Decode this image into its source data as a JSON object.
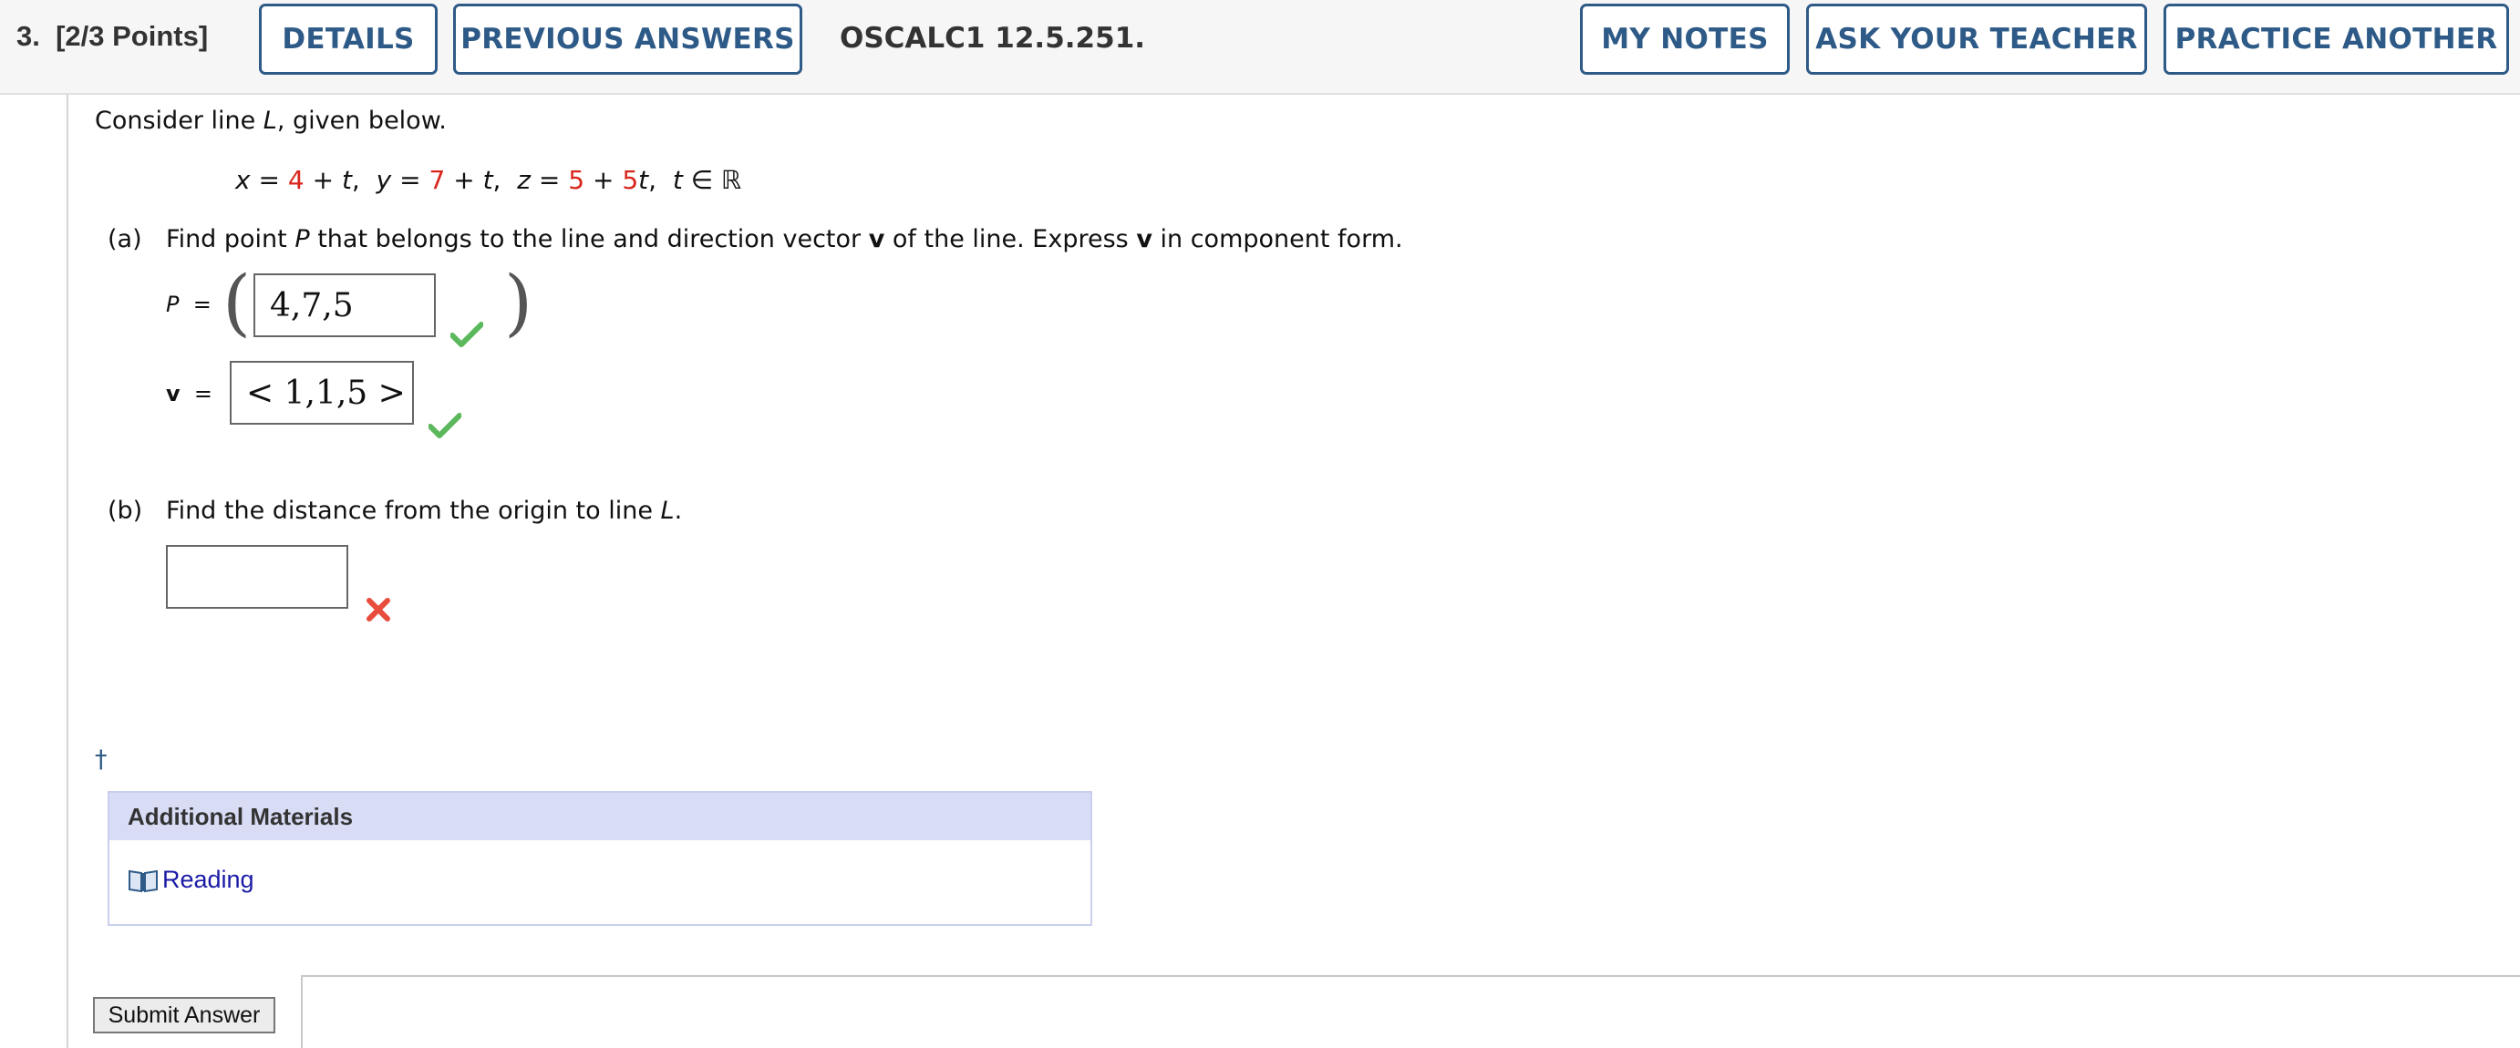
{
  "header": {
    "question_number": "3.",
    "points": "[2/3 Points]",
    "details_label": "DETAILS",
    "previous_answers_label": "PREVIOUS ANSWERS",
    "code": "OSCALC1 12.5.251.",
    "my_notes_label": "MY NOTES",
    "ask_teacher_label": "ASK YOUR TEACHER",
    "practice_label": "PRACTICE ANOTHER"
  },
  "problem": {
    "intro_prefix": "Consider line ",
    "intro_var": "L",
    "intro_suffix": ", given below.",
    "eq": {
      "x": "x",
      "eq1": " = ",
      "x0": "4",
      "x_rest": " + ",
      "t1": "t",
      "sep1": ",  ",
      "y": "y",
      "eq2": " = ",
      "y0": "7",
      "y_rest": " + ",
      "t2": "t",
      "sep2": ",  ",
      "z": "z",
      "eq3": " = ",
      "z0": "5",
      "z_rest": " + ",
      "zc": "5",
      "t3": "t",
      "sep3": ",  ",
      "t4": "t",
      "in_R": " ∈ ℝ"
    },
    "part_a": {
      "label": "(a)",
      "text_1": "Find point ",
      "var_p": "P",
      "text_2": " that belongs to the line and direction vector ",
      "var_v": "v",
      "text_3": " of the line. Express ",
      "var_v2": "v",
      "text_4": " in component form.",
      "p_label": "P",
      "eq_sign": "=",
      "p_answer": "4,7,5",
      "v_label": "v",
      "v_answer": "< 1,1,5 >"
    },
    "part_b": {
      "label": "(b)",
      "text_1": "Find the distance from the origin to line ",
      "var_l": "L",
      "text_2": ".",
      "answer": ""
    },
    "dagger": "†"
  },
  "additional": {
    "title": "Additional Materials",
    "reading_label": "Reading"
  },
  "submit_label": "Submit Answer",
  "colors": {
    "accent": "#2e5a87",
    "red": "#d9261c",
    "check": "#5cb85c",
    "x_red": "#e74c3c"
  }
}
